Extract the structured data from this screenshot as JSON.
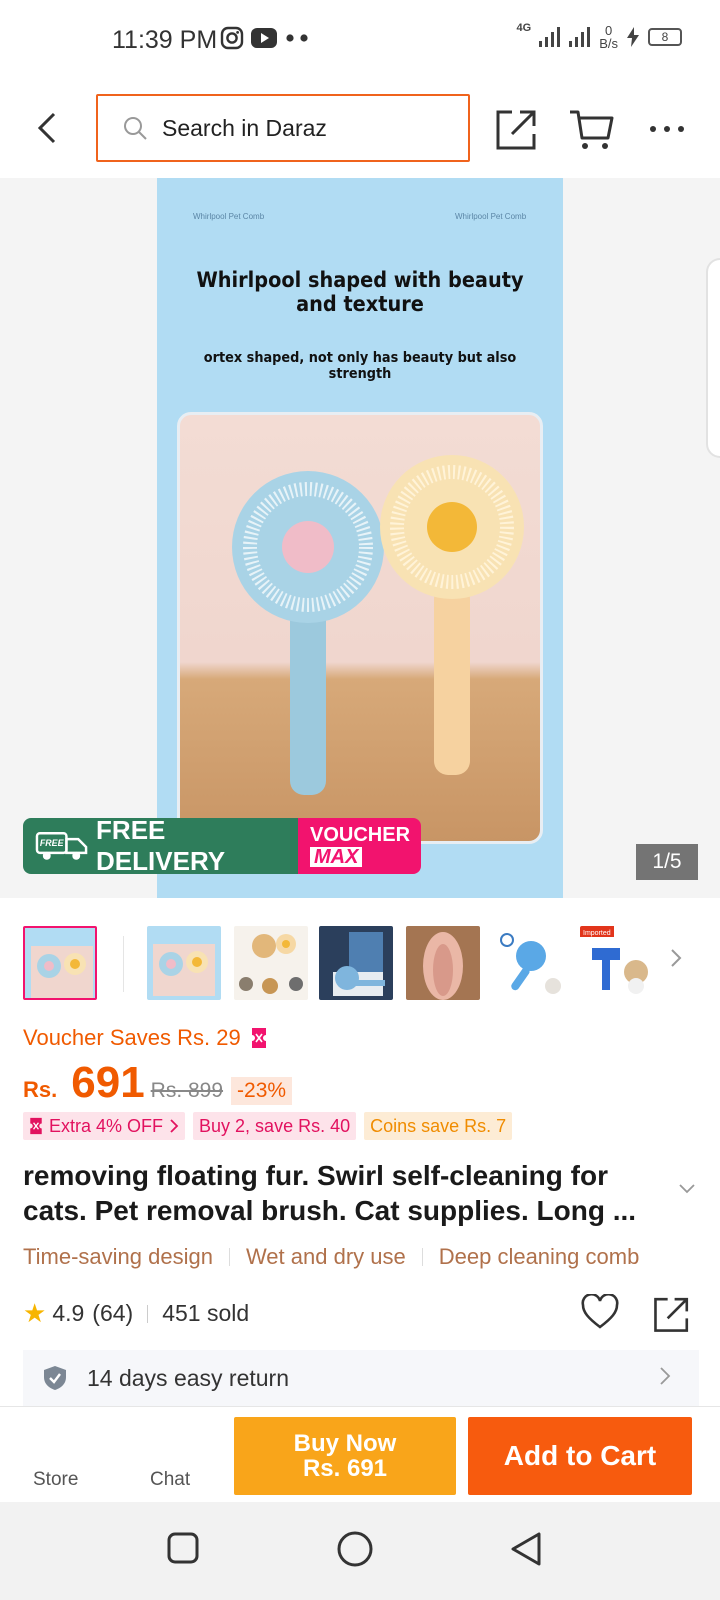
{
  "status_bar": {
    "time": "11:39 PM",
    "network": "4G",
    "speed_value": "0",
    "speed_unit": "B/s",
    "battery": "8"
  },
  "header": {
    "search_placeholder": "Search in Daraz"
  },
  "gallery": {
    "image_heading": "Whirlpool shaped with beauty and texture",
    "image_subheading": "ortex shaped, not only has beauty but also strength",
    "tiny_left": "Whirlpool Pet Comb",
    "tiny_right": "Whirlpool Pet Comb",
    "badge_free_delivery": "FREE DELIVERY",
    "badge_free": "FREE",
    "badge_voucher": "VOUCHER",
    "badge_max": "MAX",
    "counter": "1/5",
    "thumbnail_badge": "Imported"
  },
  "price": {
    "voucher_saves": "Voucher Saves Rs. 29",
    "currency": "Rs.",
    "amount": "691",
    "original": "Rs. 899",
    "discount": "-23%"
  },
  "chips": {
    "extra": "Extra 4% OFF",
    "bundle": "Buy 2, save Rs. 40",
    "coins": "Coins save Rs. 7"
  },
  "product": {
    "title": "removing floating fur. Swirl self-cleaning for cats. Pet removal brush. Cat supplies. Long ...",
    "features": [
      "Time-saving design",
      "Wet and dry use",
      "Deep cleaning comb"
    ],
    "rating": "4.9",
    "reviews": "(64)",
    "sold": "451 sold",
    "return_policy": "14 days easy return"
  },
  "actions": {
    "store": "Store",
    "chat": "Chat",
    "buy_now_line1": "Buy Now",
    "buy_now_line2": "Rs. 691",
    "add_to_cart": "Add to Cart"
  },
  "colors": {
    "accent": "#f75b0e",
    "buy_now": "#f9a51a",
    "voucher_pink": "#f2136e",
    "delivery_green": "#2e7d5b",
    "image_bg": "#b1dcf3"
  }
}
